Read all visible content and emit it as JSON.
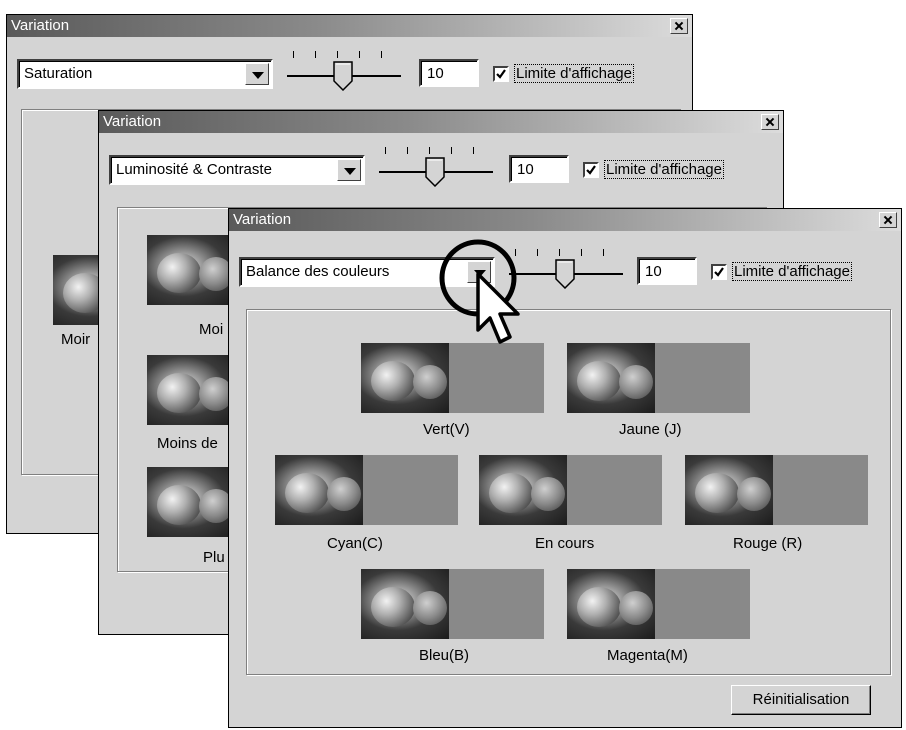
{
  "windows": [
    {
      "title": "Variation",
      "dropdown_value": "Saturation",
      "slider_value": "10",
      "checkbox_label": "Limite d'affichage",
      "checkbox_checked": true,
      "visible_labels": [
        "Moir"
      ]
    },
    {
      "title": "Variation",
      "dropdown_value": "Luminosité & Contraste",
      "slider_value": "10",
      "checkbox_label": "Limite d'affichage",
      "checkbox_checked": true,
      "visible_labels": [
        "Moi",
        "Moins de",
        "Plu"
      ]
    },
    {
      "title": "Variation",
      "dropdown_value": "Balance des couleurs",
      "slider_value": "10",
      "checkbox_label": "Limite d'affichage",
      "checkbox_checked": true,
      "variations": [
        {
          "label": "Vert(V)"
        },
        {
          "label": "Jaune (J)"
        },
        {
          "label": "Cyan(C)"
        },
        {
          "label": "En cours"
        },
        {
          "label": "Rouge (R)"
        },
        {
          "label": "Bleu(B)"
        },
        {
          "label": "Magenta(M)"
        }
      ],
      "reset_label": "Réinitialisation"
    }
  ],
  "icons": {
    "cursor": "arrow-pointer-icon",
    "highlight": "circle-highlight-icon",
    "close": "close-icon",
    "dropdown": "chevron-down-icon",
    "checkbox": "checkmark-icon"
  }
}
